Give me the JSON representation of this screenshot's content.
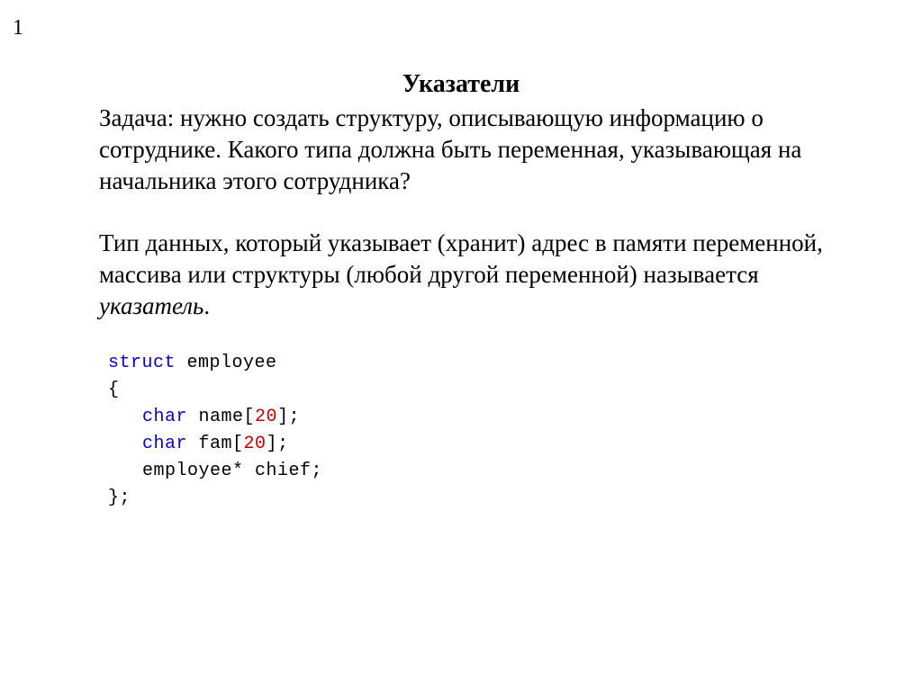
{
  "pageNumber": "1",
  "title": "Указатели",
  "paragraph1": "Задача: нужно создать структуру, описывающую информацию о сотруднике. Какого типа должна быть переменная, указывающая на начальника этого сотрудника?",
  "paragraph2_pre": "Тип данных, который указывает (хранит) адрес в памяти переменной, массива или структуры (любой другой переменной) называется ",
  "paragraph2_italic": "указатель",
  "paragraph2_post": ".",
  "code": {
    "struct_kw": "struct",
    "struct_name": " employee",
    "open_brace": "{",
    "char_kw": "char",
    "field1_name": " name",
    "field1_open": "[",
    "field1_size": "20",
    "field1_close": "];",
    "field2_name": " fam",
    "field2_open": "[",
    "field2_size": "20",
    "field2_close": "];",
    "field3": "employee* chief;",
    "close_brace": "};"
  }
}
